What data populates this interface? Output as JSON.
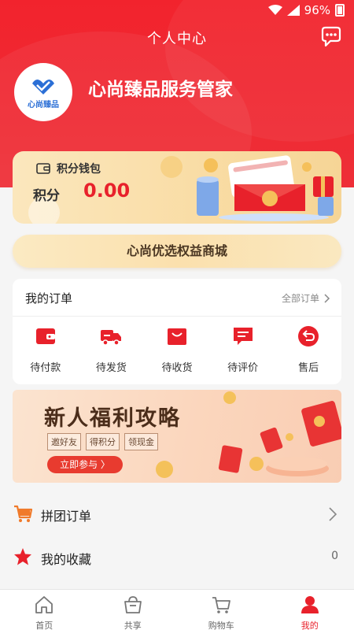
{
  "status": {
    "battery": "96%"
  },
  "header": {
    "title": "个人中心"
  },
  "profile": {
    "avatar_logo_text": "心尚臻品",
    "name": "心尚臻品服务管家"
  },
  "wallet": {
    "label": "积分钱包",
    "points_label": "积分",
    "points_value": "0.00"
  },
  "mall_button": {
    "label": "心尚优选权益商城"
  },
  "orders": {
    "title": "我的订单",
    "all_label": "全部订单",
    "items": [
      {
        "label": "待付款",
        "icon": "wallet-icon"
      },
      {
        "label": "待发货",
        "icon": "truck-icon"
      },
      {
        "label": "待收货",
        "icon": "package-icon"
      },
      {
        "label": "待评价",
        "icon": "comment-icon"
      },
      {
        "label": "售后",
        "icon": "return-icon"
      }
    ]
  },
  "promo": {
    "headline": "新人福利攻略",
    "tags": [
      "邀好友",
      "得积分",
      "领现金"
    ],
    "cta": "立即参与 〉"
  },
  "menu": [
    {
      "label": "拼团订单",
      "right": "",
      "icon": "cart-icon"
    },
    {
      "label": "我的收藏",
      "right": "0",
      "icon": "star-icon"
    }
  ],
  "tabbar": {
    "tabs": [
      {
        "label": "首页",
        "icon": "home-icon"
      },
      {
        "label": "共享",
        "icon": "basket-icon"
      },
      {
        "label": "购物车",
        "icon": "cart-icon"
      },
      {
        "label": "我的",
        "icon": "person-icon"
      }
    ],
    "active_index": 3
  },
  "colors": {
    "accent": "#e8212b",
    "hero": "#f2232d",
    "gold": "#fbe0ad"
  }
}
